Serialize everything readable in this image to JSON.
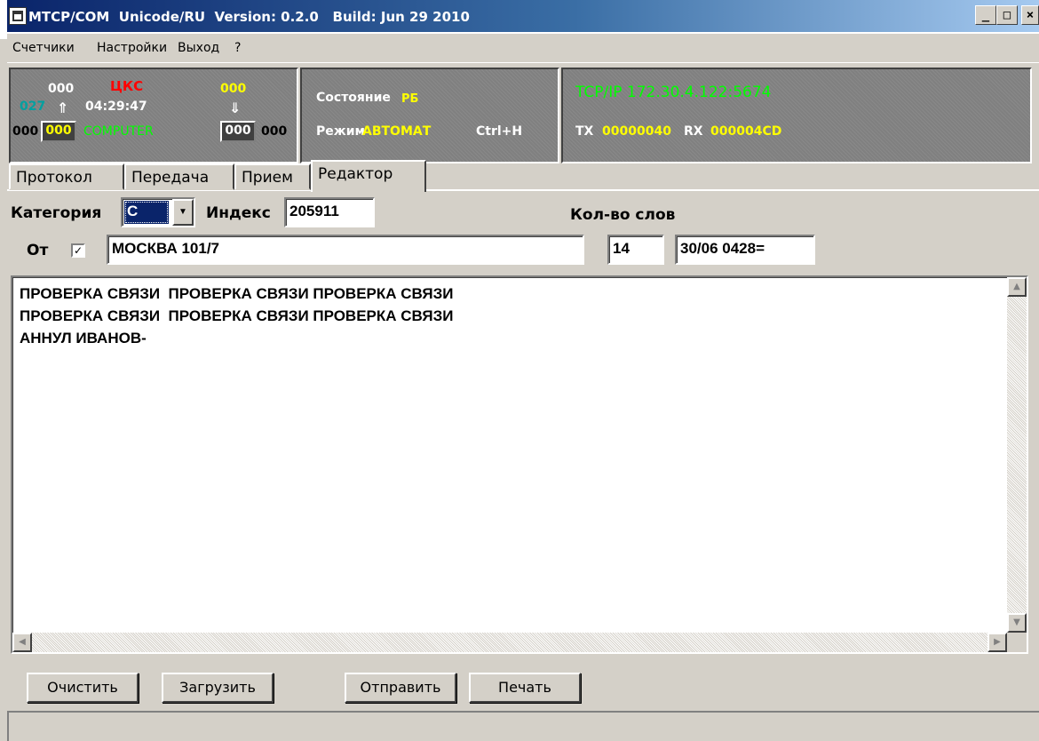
{
  "window": {
    "title": "MTCP/COM  Unicode/RU  Version: 0.2.0   Build: Jun 29 2010",
    "minimize": "_",
    "maximize": "□",
    "close": "×"
  },
  "menu": {
    "items": [
      "Счетчики",
      "Настройки",
      "Выход",
      "?"
    ]
  },
  "status_panel": {
    "counter_left_top": "000",
    "counter_left_blue": "027",
    "counter_left_bottom": "000",
    "counter_left_box": "000",
    "cks_label": "ЦКС",
    "time": "04:29:47",
    "computer_label": "COMPUTER",
    "counter_right_top": "000",
    "counter_right_box": "000",
    "counter_right_bottom": "000",
    "arrow_up": "⇑",
    "arrow_down": "⇓",
    "colors": {
      "red": "#ff0000",
      "yellow": "#ffff00",
      "green": "#00ff00",
      "teal": "#008080"
    }
  },
  "state_panel": {
    "state_label": "Состояние",
    "state_value": "РБ",
    "mode_label": "Режим",
    "mode_value": "АВТОМАТ",
    "hotkey": "Ctrl+H"
  },
  "net_panel": {
    "connection": "TCP/IP 172.30.4.122:5674",
    "tx_label": "TX",
    "tx_value": "00000040",
    "rx_label": "RX",
    "rx_value": "000004CD"
  },
  "tabs": [
    "Протокол",
    "Передача",
    "Прием",
    "Редактор"
  ],
  "active_tab": "Редактор",
  "editor": {
    "category_label": "Категория",
    "category_value": "C",
    "index_label": "Индекс",
    "index_value": "205911",
    "word_count_label": "Кол-во слов",
    "from_label": "От",
    "from_checked": true,
    "from_value": "МОСКВА 101/7",
    "word_count_value": "14",
    "datetime_value": "30/06 0428=",
    "message_lines": [
      "ПРОВЕРКА СВЯЗИ  ПРОВЕРКА СВЯЗИ ПРОВЕРКА СВЯЗИ",
      "ПРОВЕРКА СВЯЗИ  ПРОВЕРКА СВЯЗИ ПРОВЕРКА СВЯЗИ",
      "АННУЛ ИВАНОВ-"
    ]
  },
  "buttons": {
    "clear": "Очистить",
    "load": "Загрузить",
    "send": "Отправить",
    "print": "Печать"
  }
}
